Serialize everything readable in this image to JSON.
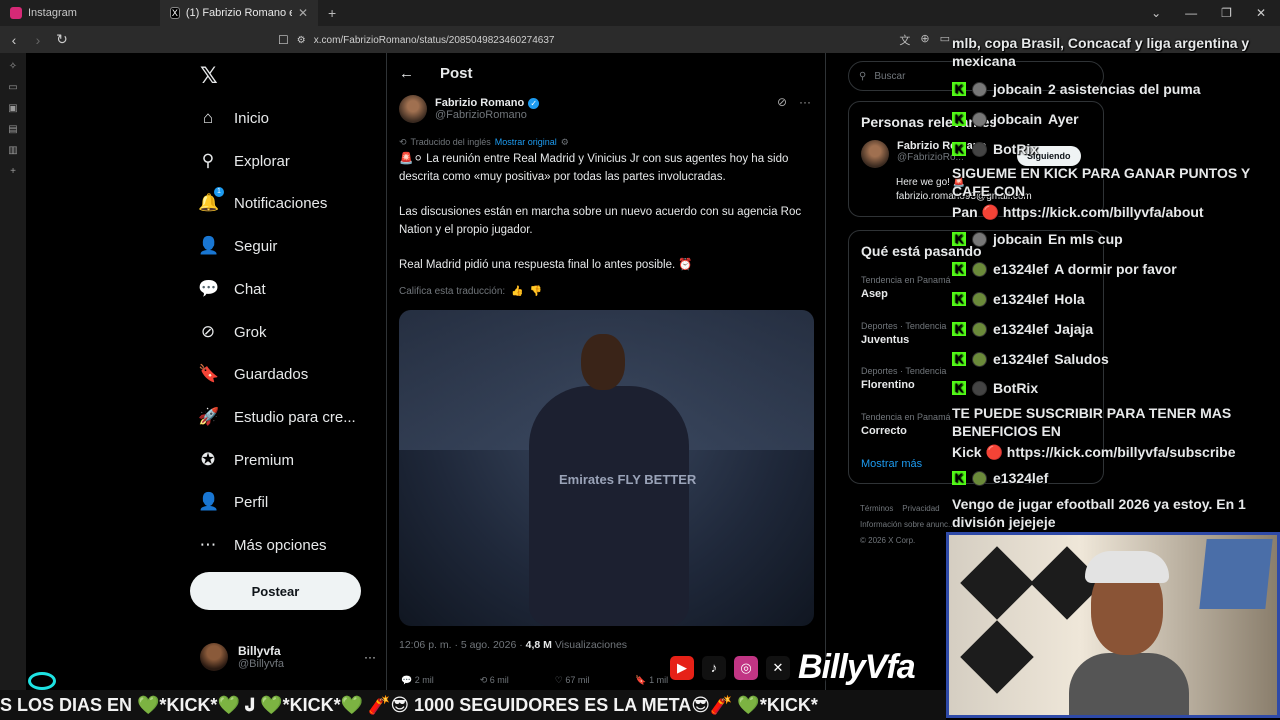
{
  "browser": {
    "tabs": [
      {
        "title": "Instagram",
        "favicon_color": "#d62976"
      },
      {
        "title": "(1) Fabrizio Romano en X: \"",
        "favicon_color": "#000000",
        "active": true
      }
    ],
    "new_tab": "+",
    "url": "x.com/FabrizioRomano/status/2085049823460274637"
  },
  "nav": {
    "logo": "𝕏",
    "items": [
      {
        "label": "Inicio",
        "icon": "home-icon",
        "glyph": "⌂"
      },
      {
        "label": "Explorar",
        "icon": "search-icon",
        "glyph": "⚲"
      },
      {
        "label": "Notificaciones",
        "icon": "bell-icon",
        "glyph": "🔔",
        "badge": "1"
      },
      {
        "label": "Seguir",
        "icon": "follow-icon",
        "glyph": "👤"
      },
      {
        "label": "Chat",
        "icon": "chat-icon",
        "glyph": "💬"
      },
      {
        "label": "Grok",
        "icon": "grok-icon",
        "glyph": "⊘"
      },
      {
        "label": "Guardados",
        "icon": "bookmark-icon",
        "glyph": "🔖"
      },
      {
        "label": "Estudio para cre...",
        "icon": "rocket-icon",
        "glyph": "🚀"
      },
      {
        "label": "Premium",
        "icon": "premium-icon",
        "glyph": "✪"
      },
      {
        "label": "Perfil",
        "icon": "profile-icon",
        "glyph": "👤"
      },
      {
        "label": "Más opciones",
        "icon": "more-icon",
        "glyph": "⋯"
      }
    ],
    "post_button": "Postear",
    "profile": {
      "name": "Billyvfa",
      "handle": "@Billyvfa",
      "more": "···"
    }
  },
  "post": {
    "header": "Post",
    "author": {
      "name": "Fabrizio Romano",
      "handle": "@FabrizioRomano"
    },
    "translated_label": "Traducido del inglés",
    "show_original": "Mostrar original",
    "paragraphs": [
      "🚨⚪ La reunión entre Real Madrid y Vinicius Jr con sus agentes hoy ha sido descrita como «muy positiva» por todas las partes involucradas.",
      "Las discusiones están en marcha sobre un nuevo acuerdo con su agencia Roc Nation y el propio jugador.",
      "Real Madrid pidió una respuesta final lo antes posible. ⏰"
    ],
    "rate_translation": "Califica esta traducción:",
    "image_sponsor": "Emirates FLY BETTER",
    "time": "12:06 p. m. · 5 ago. 2026 · ",
    "views_count": "4,8 M",
    "views_label": " Visualizaciones",
    "stats": {
      "replies": "2 mil",
      "reposts": "6 mil",
      "likes": "67 mil",
      "bookmarks": "1 mil"
    }
  },
  "sidebar": {
    "search_placeholder": "Buscar",
    "relevant_title": "Personas relevantes",
    "relevant_person": {
      "name": "Fabrizio Romano",
      "handle": "@FabrizioRo...",
      "bio_line1": "Here we go! 🚨",
      "bio_line2": "fabrizio.romano93@gmail.com",
      "follow": "Siguiendo"
    },
    "trending_title": "Qué está pasando",
    "trends": [
      {
        "context": "Tendencia en Panamá",
        "topic": "Asep"
      },
      {
        "context": "Deportes · Tendencia",
        "topic": "Juventus"
      },
      {
        "context": "Deportes · Tendencia",
        "topic": "Florentino"
      },
      {
        "context": "Tendencia en Panamá",
        "topic": "Correcto"
      }
    ],
    "show_more": "Mostrar más",
    "footer": [
      "Términos",
      "Privacidad",
      "Información sobre anunc...",
      "© 2026 X Corp."
    ]
  },
  "chat": {
    "top_text": "mlb, copa Brasil, Concacaf y liga argentina y mexicana",
    "messages": [
      {
        "user": "jobcain",
        "text": "2 asistencias del puma",
        "avatar": "gray"
      },
      {
        "user": "jobcain",
        "text": "Ayer",
        "avatar": "gray"
      },
      {
        "user": "BotRix",
        "text": "",
        "avatar": "bot"
      },
      {
        "user": "jobcain",
        "text": "En mls cup",
        "avatar": "gray"
      },
      {
        "user": "e1324lef",
        "text": "A dormir por favor",
        "avatar": "green"
      },
      {
        "user": "e1324lef",
        "text": "Hola",
        "avatar": "green"
      },
      {
        "user": "e1324lef",
        "text": "Jajaja",
        "avatar": "green"
      },
      {
        "user": "e1324lef",
        "text": "Saludos",
        "avatar": "green"
      },
      {
        "user": "BotRix",
        "text": "",
        "avatar": "bot"
      },
      {
        "user": "e1324lef",
        "text": "",
        "avatar": "green"
      }
    ],
    "bot_promo_1": "SIGUEME EN KICK PARA GANAR PUNTOS Y CAFE CON",
    "bot_promo_1_link": "Pan 🔴 https://kick.com/billyvfa/about",
    "bot_promo_2": "TE PUEDE SUSCRIBIR PARA TENER MAS BENEFICIOS EN",
    "bot_promo_2_link": "Kick 🔴 https://kick.com/billyvfa/subscribe",
    "last_text": "Vengo de jugar efootball 2026 ya estoy. En 1 división jejejeje"
  },
  "overlay": {
    "brand": "BillyVfa",
    "ticker": "S LOS DIAS EN 💚*KICK*💚        𝐉        💚*KICK*💚 🧨😎 1000 SEGUIDORES ES LA META😎🧨 💚*KICK*"
  },
  "colors": {
    "accent": "#1d9bf0",
    "kick": "#53fc18",
    "bg": "#000000"
  }
}
